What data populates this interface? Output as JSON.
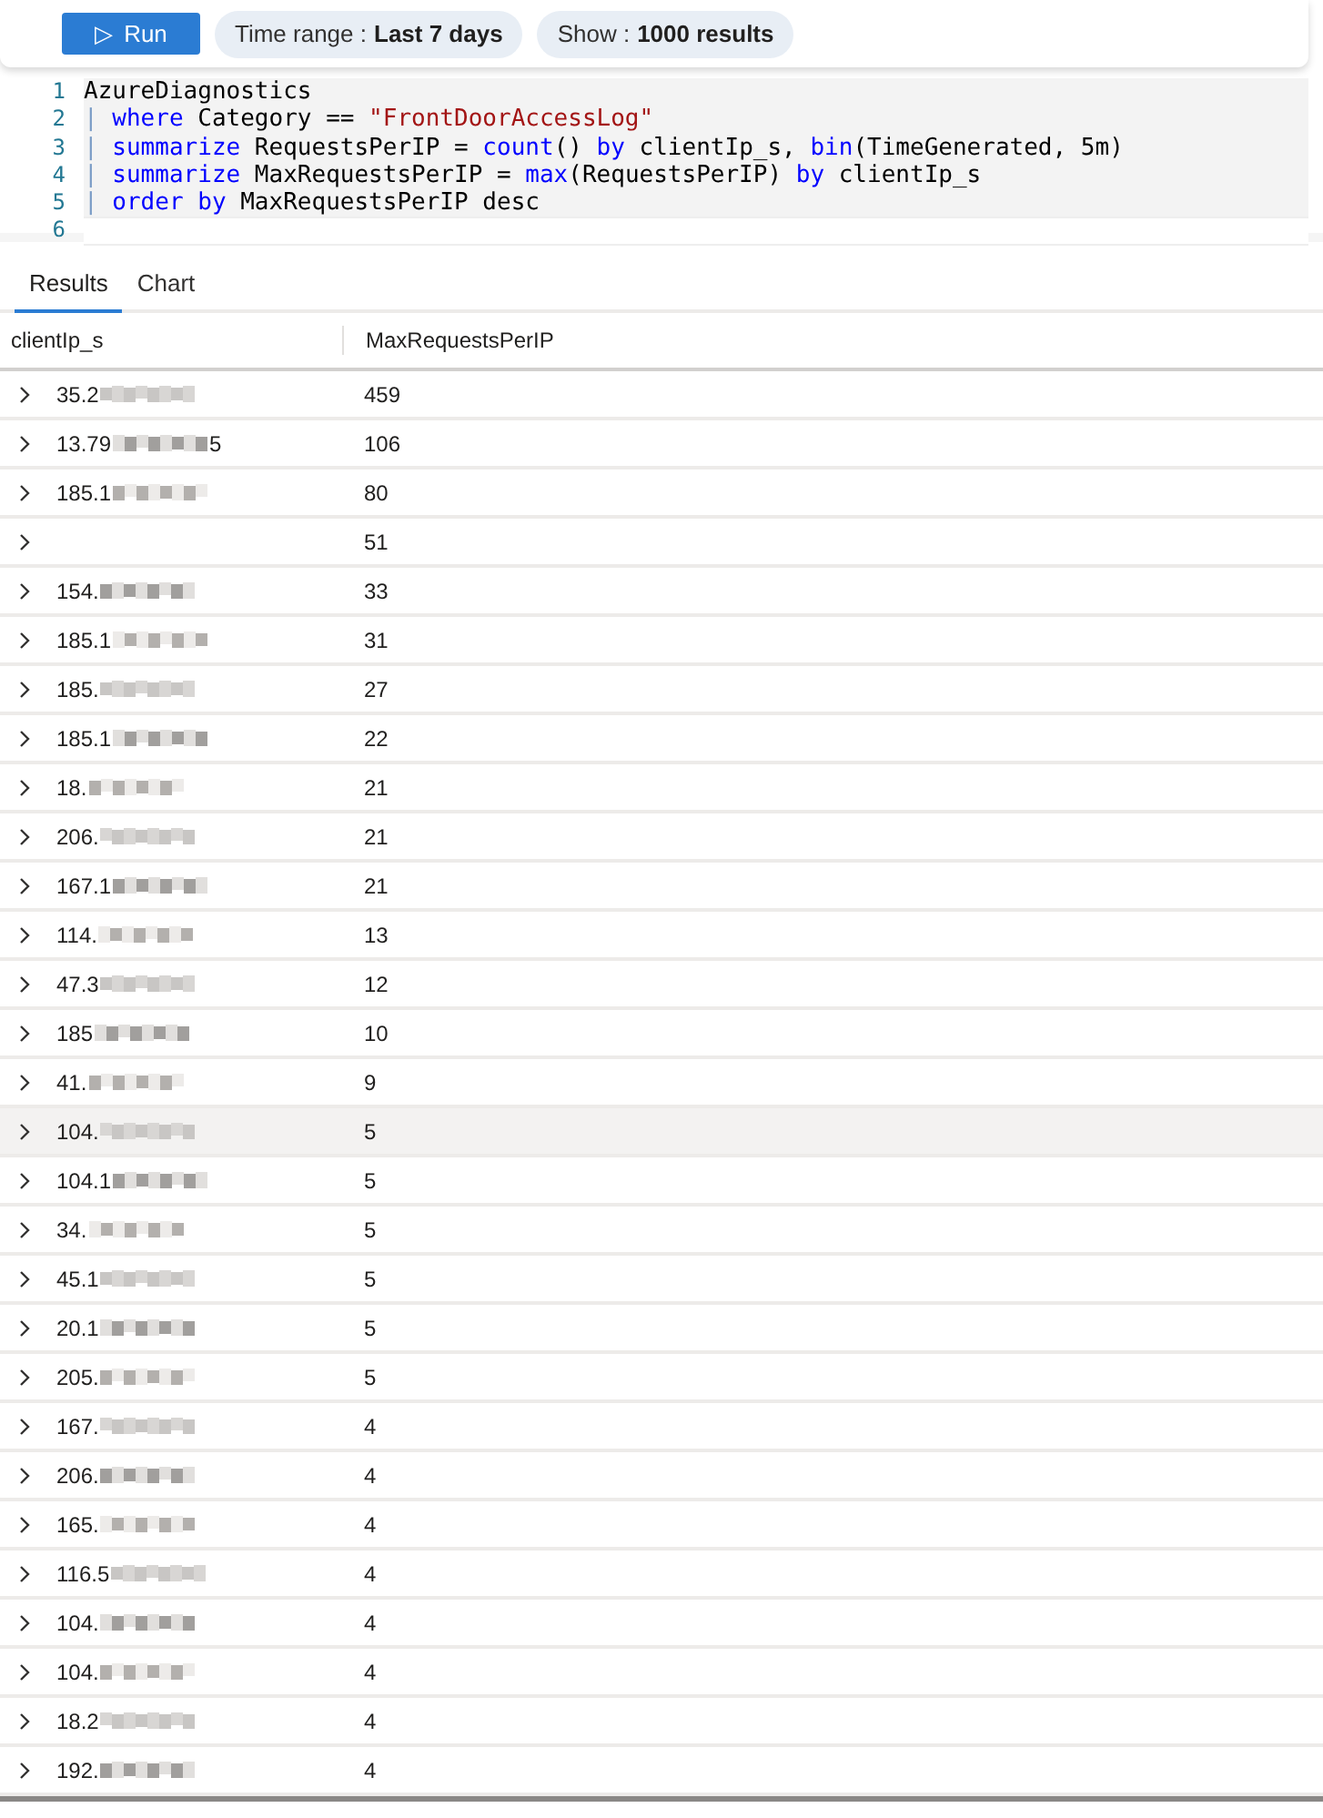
{
  "toolbar": {
    "run_button": {
      "icon": "▷",
      "label": "Run"
    },
    "time_range": {
      "label": "Time range :",
      "value": "Last 7 days"
    },
    "show": {
      "label": "Show :",
      "value": "1000 results"
    }
  },
  "editor": {
    "lines": [
      {
        "number": "1",
        "tokens": [
          {
            "kind": "plain",
            "text": "AzureDiagnostics"
          }
        ]
      },
      {
        "number": "2",
        "tokens": [
          {
            "kind": "pipe",
            "text": "| "
          },
          {
            "kind": "keyword",
            "text": "where"
          },
          {
            "kind": "plain",
            "text": " Category == "
          },
          {
            "kind": "string",
            "text": "\"FrontDoorAccessLog\""
          }
        ]
      },
      {
        "number": "3",
        "tokens": [
          {
            "kind": "pipe",
            "text": "| "
          },
          {
            "kind": "keyword",
            "text": "summarize"
          },
          {
            "kind": "plain",
            "text": " RequestsPerIP = "
          },
          {
            "kind": "keyword",
            "text": "count"
          },
          {
            "kind": "plain",
            "text": "() "
          },
          {
            "kind": "keyword",
            "text": "by"
          },
          {
            "kind": "plain",
            "text": " clientIp_s, "
          },
          {
            "kind": "keyword",
            "text": "bin"
          },
          {
            "kind": "plain",
            "text": "(TimeGenerated, 5m)"
          }
        ]
      },
      {
        "number": "4",
        "tokens": [
          {
            "kind": "pipe",
            "text": "| "
          },
          {
            "kind": "keyword",
            "text": "summarize"
          },
          {
            "kind": "plain",
            "text": " MaxRequestsPerIP = "
          },
          {
            "kind": "keyword",
            "text": "max"
          },
          {
            "kind": "plain",
            "text": "(RequestsPerIP) "
          },
          {
            "kind": "keyword",
            "text": "by"
          },
          {
            "kind": "plain",
            "text": " clientIp_s"
          }
        ]
      },
      {
        "number": "5",
        "tokens": [
          {
            "kind": "pipe",
            "text": "| "
          },
          {
            "kind": "keyword",
            "text": "order by"
          },
          {
            "kind": "plain",
            "text": " MaxRequestsPerIP desc"
          }
        ]
      },
      {
        "number": "6"
      }
    ]
  },
  "tabs": [
    {
      "label": "Results",
      "selected": true
    },
    {
      "label": "Chart",
      "selected": false
    }
  ],
  "table": {
    "columns": [
      "clientIp_s",
      "MaxRequestsPerIP"
    ],
    "rows": [
      {
        "ip": "35.2",
        "redacted": true,
        "value": "459",
        "highlighted": false
      },
      {
        "ip": "13.79",
        "redacted": true,
        "ip_end": "5",
        "value": "106",
        "highlighted": false
      },
      {
        "ip": "185.1",
        "redacted": true,
        "value": "80",
        "highlighted": false
      },
      {
        "redacted": false,
        "value": "51",
        "highlighted": false
      },
      {
        "ip": "154.",
        "redacted": true,
        "value": "33",
        "highlighted": false
      },
      {
        "ip": "185.1",
        "redacted": true,
        "value": "31",
        "highlighted": false
      },
      {
        "ip": "185.",
        "redacted": true,
        "value": "27",
        "highlighted": false
      },
      {
        "ip": "185.1",
        "redacted": true,
        "value": "22",
        "highlighted": false
      },
      {
        "ip": "18.",
        "redacted": true,
        "value": "21",
        "highlighted": false
      },
      {
        "ip": "206.",
        "redacted": true,
        "value": "21",
        "highlighted": false
      },
      {
        "ip": "167.1",
        "redacted": true,
        "value": "21",
        "highlighted": false
      },
      {
        "ip": "114.",
        "redacted": true,
        "value": "13",
        "highlighted": false
      },
      {
        "ip": "47.3",
        "redacted": true,
        "value": "12",
        "highlighted": false
      },
      {
        "ip": "185",
        "redacted": true,
        "value": "10",
        "highlighted": false
      },
      {
        "ip": "41.",
        "redacted": true,
        "value": "9",
        "highlighted": false
      },
      {
        "ip": "104.",
        "redacted": true,
        "value": "5",
        "highlighted": true
      },
      {
        "ip": "104.1",
        "redacted": true,
        "value": "5",
        "highlighted": false
      },
      {
        "ip": "34.",
        "redacted": true,
        "value": "5",
        "highlighted": false
      },
      {
        "ip": "45.1",
        "redacted": true,
        "value": "5",
        "highlighted": false
      },
      {
        "ip": "20.1",
        "redacted": true,
        "value": "5",
        "highlighted": false
      },
      {
        "ip": "205.",
        "redacted": true,
        "value": "5",
        "highlighted": false
      },
      {
        "ip": "167.",
        "redacted": true,
        "value": "4",
        "highlighted": false
      },
      {
        "ip": "206.",
        "redacted": true,
        "value": "4",
        "highlighted": false
      },
      {
        "ip": "165.",
        "redacted": true,
        "value": "4",
        "highlighted": false
      },
      {
        "ip": "116.5",
        "redacted": true,
        "value": "4",
        "highlighted": false
      },
      {
        "ip": "104.",
        "redacted": true,
        "value": "4",
        "highlighted": false
      },
      {
        "ip": "104.",
        "redacted": true,
        "value": "4",
        "highlighted": false
      },
      {
        "ip": "18.2",
        "redacted": true,
        "value": "4",
        "highlighted": false
      },
      {
        "ip": "192.",
        "redacted": true,
        "value": "4",
        "highlighted": false
      }
    ]
  }
}
